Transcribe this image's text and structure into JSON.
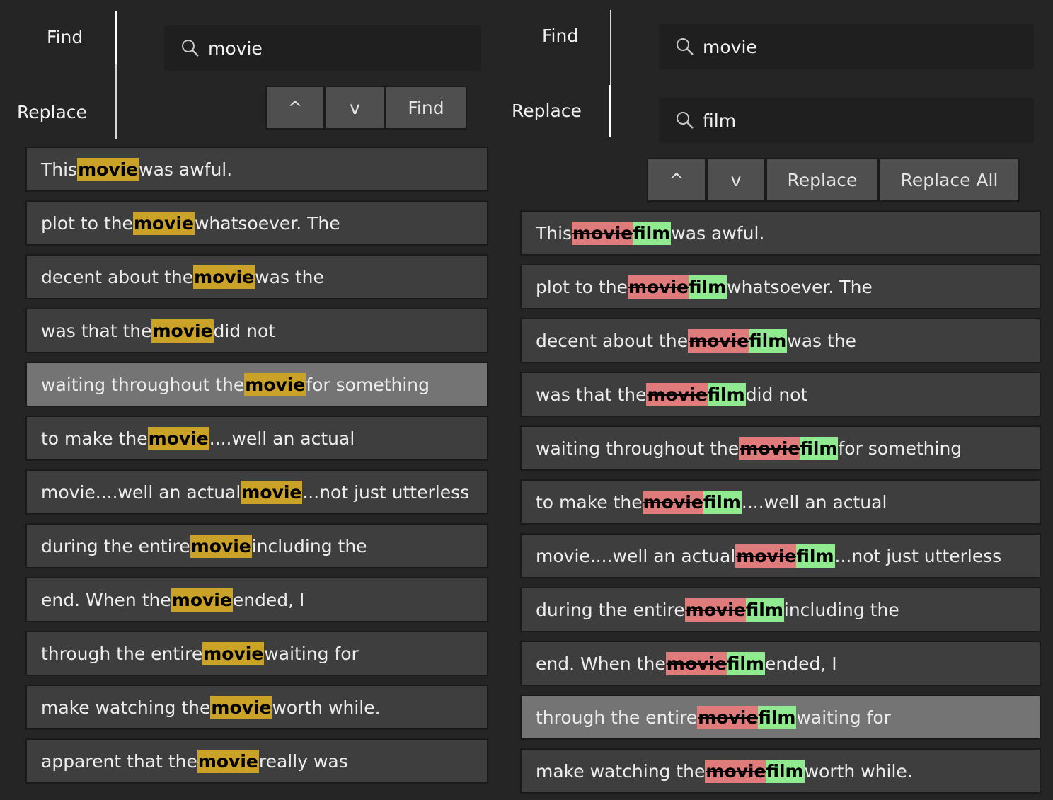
{
  "find_panel": {
    "tabs": {
      "find": "Find",
      "replace": "Replace"
    },
    "search": {
      "value": "movie"
    },
    "buttons": {
      "prev": "^",
      "next": "v",
      "find": "Find"
    },
    "results": [
      {
        "before": "This ",
        "match": "movie",
        "after": " was awful."
      },
      {
        "before": "plot to the ",
        "match": "movie",
        "after": " whatsoever. The"
      },
      {
        "before": "decent about the ",
        "match": "movie",
        "after": " was the"
      },
      {
        "before": "was that the ",
        "match": "movie",
        "after": " did not"
      },
      {
        "before": "waiting throughout the ",
        "match": "movie",
        "after": " for something"
      },
      {
        "before": "to make the ",
        "match": "movie",
        "after": "....well an actual"
      },
      {
        "before": "movie....well an actual ",
        "match": "movie",
        "after": "...not just utterless"
      },
      {
        "before": "during the entire ",
        "match": "movie",
        "after": " including the"
      },
      {
        "before": "end. When the ",
        "match": "movie",
        "after": " ended, I"
      },
      {
        "before": "through the entire ",
        "match": "movie",
        "after": " waiting for"
      },
      {
        "before": "make watching the ",
        "match": "movie",
        "after": " worth while."
      },
      {
        "before": "apparent that the ",
        "match": "movie",
        "after": " really was"
      }
    ],
    "selected_index": 4
  },
  "replace_panel": {
    "tabs": {
      "find": "Find",
      "replace": "Replace"
    },
    "search": {
      "value": "movie"
    },
    "replace": {
      "value": "film"
    },
    "buttons": {
      "prev": "^",
      "next": "v",
      "replace": "Replace",
      "replace_all": "Replace All"
    },
    "results": [
      {
        "before": "This ",
        "old": "movie",
        "new": "film",
        "after": " was awful."
      },
      {
        "before": "plot to the ",
        "old": "movie",
        "new": "film",
        "after": " whatsoever. The"
      },
      {
        "before": "decent about the ",
        "old": "movie",
        "new": "film",
        "after": " was the"
      },
      {
        "before": "was that the ",
        "old": "movie",
        "new": "film",
        "after": " did not"
      },
      {
        "before": "waiting throughout the ",
        "old": "movie",
        "new": "film",
        "after": " for something"
      },
      {
        "before": "to make the ",
        "old": "movie",
        "new": "film",
        "after": "....well an actual"
      },
      {
        "before": "movie....well an actual ",
        "old": "movie",
        "new": "film",
        "after": "...not just utterless"
      },
      {
        "before": "during the entire ",
        "old": "movie",
        "new": "film",
        "after": " including the"
      },
      {
        "before": "end. When the ",
        "old": "movie",
        "new": "film",
        "after": " ended, I"
      },
      {
        "before": "through the entire ",
        "old": "movie",
        "new": "film",
        "after": " waiting for"
      },
      {
        "before": "make watching the ",
        "old": "movie",
        "new": "film",
        "after": " worth while."
      }
    ],
    "selected_index": 9
  },
  "colors": {
    "background": "#252525",
    "row": "#3e3e3e",
    "row_selected": "#747474",
    "match_highlight": "#c9a227",
    "removed_highlight": "#e07b7b",
    "added_highlight": "#90ea90"
  }
}
